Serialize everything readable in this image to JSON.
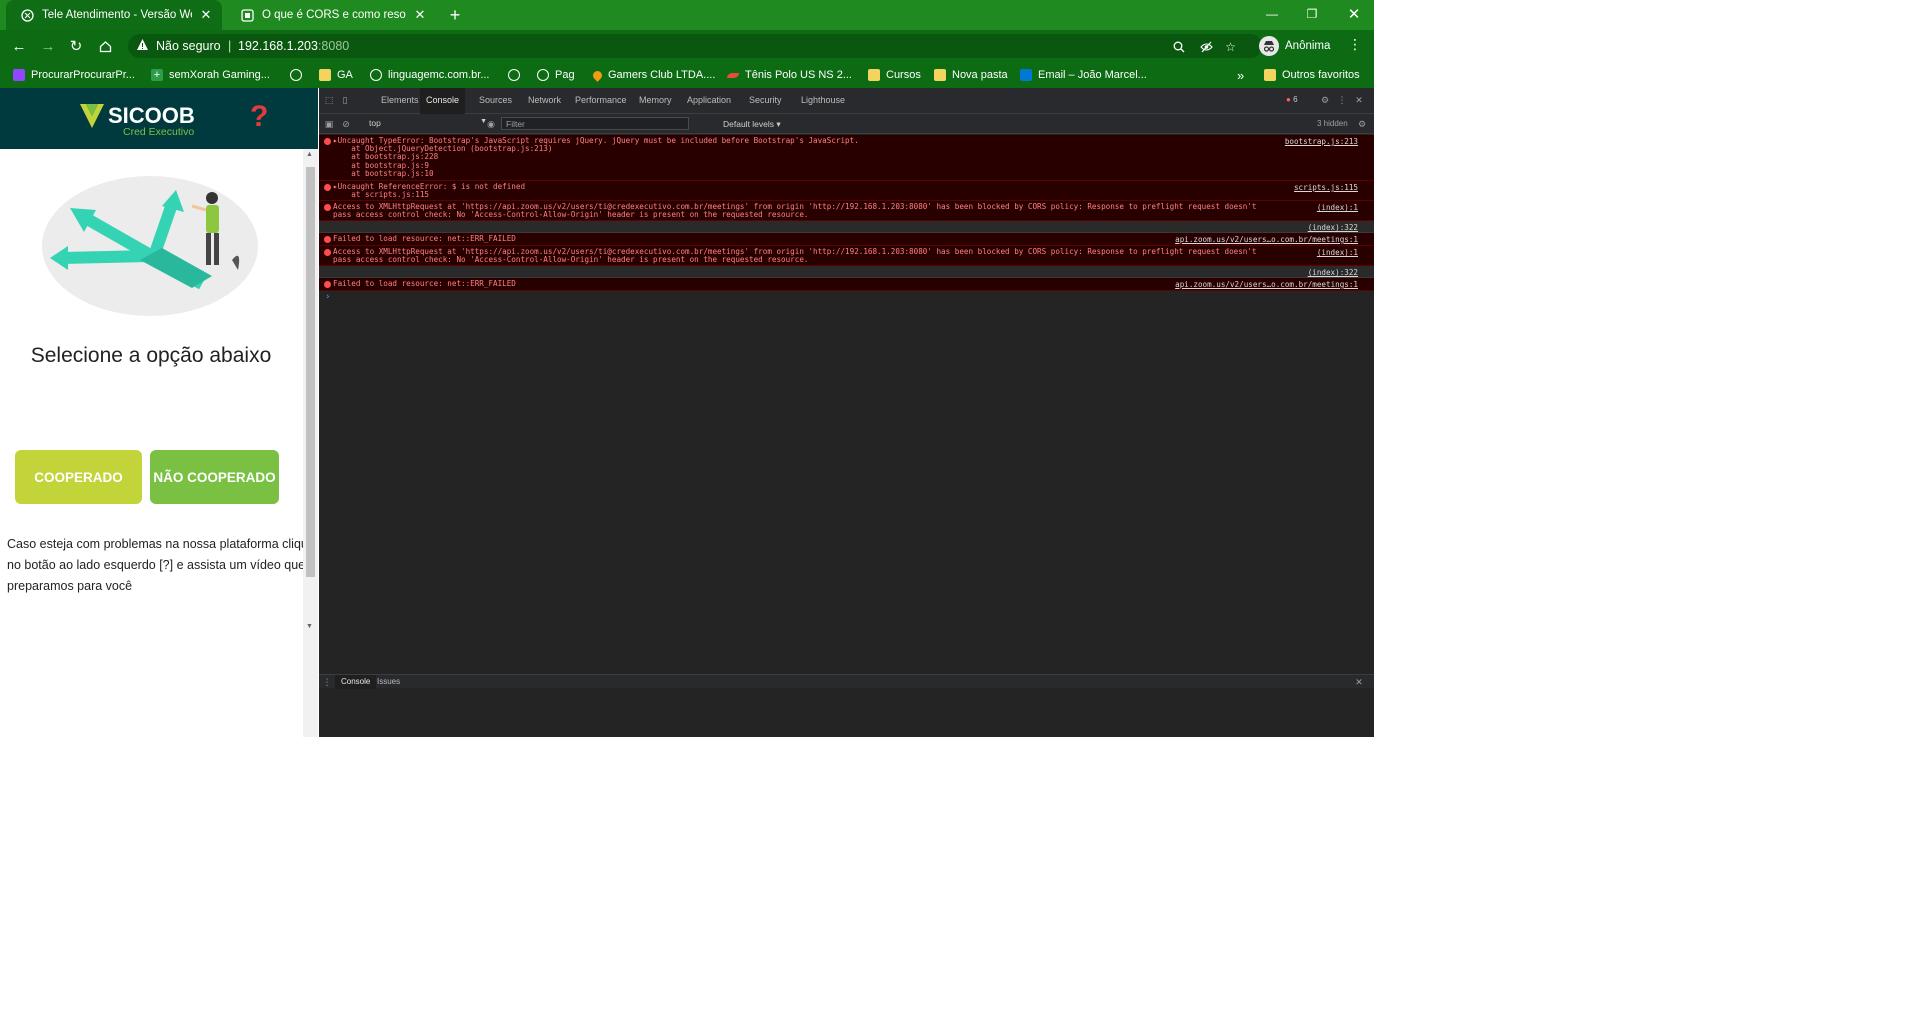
{
  "browser": {
    "tabs": [
      {
        "title": "Tele Atendimento - Versão Web",
        "active": true
      },
      {
        "title": "O que é CORS e como resolver o",
        "active": false
      }
    ],
    "window_controls": [
      "minimize-icon",
      "restore-icon",
      "close-icon"
    ],
    "address": {
      "security": "Não seguro",
      "host": "192.168.1.203",
      "port": ":8080"
    },
    "profile": "Anônima",
    "bookmarks": [
      {
        "label": "ProcurarProcurarPr...",
        "icon": "twitch-icon",
        "color": "#9146ff"
      },
      {
        "label": "semXorah Gaming...",
        "icon": "plus-icon",
        "color": "#2e9d4a"
      },
      {
        "label": "",
        "icon": "globe-icon",
        "color": "#ffffff"
      },
      {
        "label": "GA",
        "icon": "folder-icon",
        "color": "#f4d35e"
      },
      {
        "label": "linguagemc.com.br...",
        "icon": "globe-icon",
        "color": "#ffffff"
      },
      {
        "label": "",
        "icon": "globe-icon",
        "color": "#ffffff"
      },
      {
        "label": "Pag",
        "icon": "globe-icon",
        "color": "#ffffff"
      },
      {
        "label": "Gamers Club LTDA....",
        "icon": "location-icon",
        "color": "#f39c12"
      },
      {
        "label": "Tênis Polo US NS 2...",
        "icon": "nike-icon",
        "color": "#e74c3c"
      },
      {
        "label": "Cursos",
        "icon": "folder-icon",
        "color": "#f4d35e"
      },
      {
        "label": "Nova pasta",
        "icon": "folder-icon",
        "color": "#f4d35e"
      },
      {
        "label": "Email – João Marcel...",
        "icon": "outlook-icon",
        "color": "#0078d4"
      }
    ],
    "more_bookmarks": "»",
    "other_bookmarks": "Outros favoritos"
  },
  "page": {
    "logo_text": "SICOOB",
    "logo_sub": "Cred Executivo",
    "help_symbol": "?",
    "title": "Selecione a opção abaixo",
    "btn_coop": "COOPERADO",
    "btn_noncoop": "NÃO COOPERADO",
    "help_lines": [
      "Caso esteja com problemas na nossa plataforma cliqu",
      "no botão ao lado esquerdo [?] e assista um vídeo que",
      "preparamos para você"
    ]
  },
  "devtools": {
    "tabs": [
      "Elements",
      "Console",
      "Sources",
      "Network",
      "Performance",
      "Memory",
      "Application",
      "Security",
      "Lighthouse"
    ],
    "active_tab": "Console",
    "error_count": "6",
    "context": "top",
    "filter_placeholder": "Filter",
    "levels": "Default levels ▾",
    "hidden": "3 hidden",
    "messages": [
      {
        "lines": [
          "▸Uncaught TypeError: Bootstrap's JavaScript requires jQuery. jQuery must be included before Bootstrap's JavaScript.",
          "    at Object.jQueryDetection (bootstrap.js:213)",
          "    at bootstrap.js:228",
          "    at bootstrap.js:9",
          "    at bootstrap.js:10"
        ],
        "source": "bootstrap.js:213"
      },
      {
        "lines": [
          "▸Uncaught ReferenceError: $ is not defined",
          "    at scripts.js:115"
        ],
        "source": "scripts.js:115"
      },
      {
        "lines": [
          "Access to XMLHttpRequest at 'https://api.zoom.us/v2/users/ti@credexecutivo.com.br/meetings' from origin 'http://192.168.1.203:8080' has been blocked by CORS policy: Response to preflight request doesn't",
          "pass access control check: No 'Access-Control-Allow-Origin' header is present on the requested resource."
        ],
        "source": "(index):1",
        "context_source": "(index):322"
      },
      {
        "lines": [
          "Failed to load resource: net::ERR_FAILED"
        ],
        "source": "api.zoom.us/v2/users…o.com.br/meetings:1"
      },
      {
        "lines": [
          "Access to XMLHttpRequest at 'https://api.zoom.us/v2/users/ti@credexecutivo.com.br/meetings' from origin 'http://192.168.1.203:8080' has been blocked by CORS policy: Response to preflight request doesn't",
          "pass access control check: No 'Access-Control-Allow-Origin' header is present on the requested resource."
        ],
        "source": "(index):1",
        "context_source": "(index):322"
      },
      {
        "lines": [
          "Failed to load resource: net::ERR_FAILED"
        ],
        "source": "api.zoom.us/v2/users…o.com.br/meetings:1"
      }
    ],
    "prompt": "›",
    "drawer_tabs": [
      "Console",
      "Issues"
    ]
  },
  "colors": {
    "chrome_frame": "#1f8a1f",
    "chrome_toolbar": "#0d6b14",
    "sicoob_header": "#003a3f",
    "btn_coop": "#c3d43a",
    "btn_noncoop": "#7ac143",
    "console_error_bg": "#290000",
    "console_error_text": "#ff8080"
  }
}
